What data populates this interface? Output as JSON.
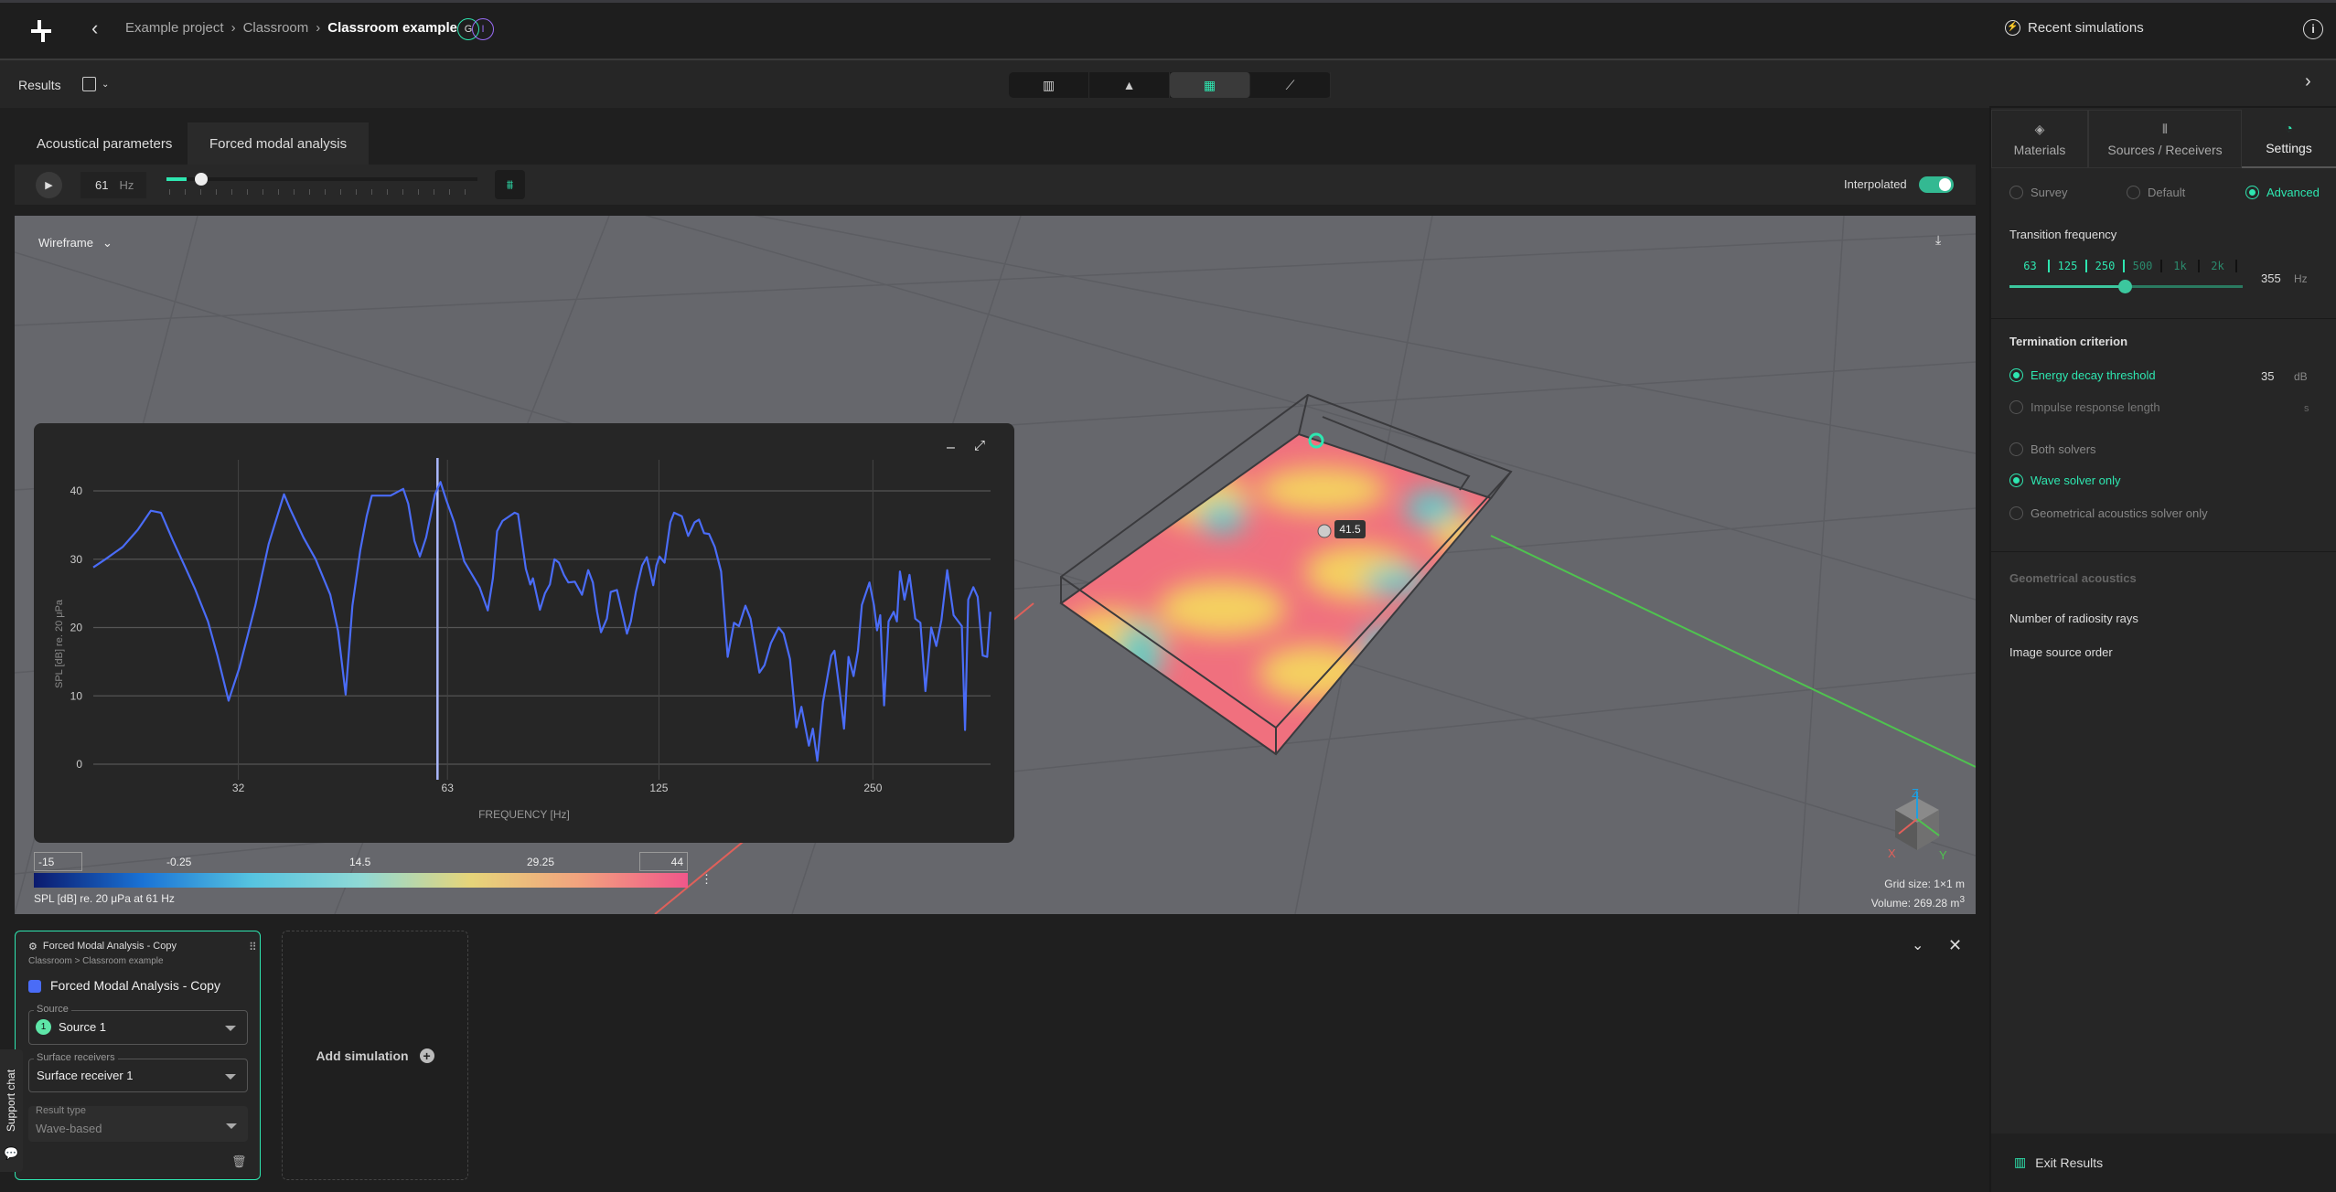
{
  "header": {
    "breadcrumb": [
      "Example project",
      "Classroom",
      "Classroom example"
    ],
    "separator": "›",
    "avatars": [
      "G",
      "I"
    ],
    "recent_simulations": "Recent simulations"
  },
  "toolbar": {
    "results_label": "Results",
    "view_buttons": [
      "results-chart-icon",
      "source-icon",
      "heatmap-icon",
      "graph-icon"
    ],
    "active_view": 2
  },
  "tabs": [
    {
      "label": "Acoustical parameters",
      "active": false
    },
    {
      "label": "Forced modal analysis",
      "active": true
    }
  ],
  "playback": {
    "frequency": "61",
    "unit": "Hz",
    "slider_fraction": 0.06,
    "interpolated_label": "Interpolated",
    "interpolated": true
  },
  "viewport": {
    "display_mode": "Wireframe",
    "probe_value": "41.5",
    "grid_size": "Grid size: 1×1 m",
    "volume": "Volume: 269.28 m",
    "volume_sup": "3",
    "axes": [
      "X",
      "Y",
      "Z"
    ]
  },
  "colorbar": {
    "min": "-15",
    "ticks": [
      "-0.25",
      "14.5",
      "29.25"
    ],
    "max": "44",
    "caption": "SPL [dB] re. 20 μPa at 61 Hz",
    "colors": [
      "#0b1a6e",
      "#1a73d6",
      "#56c4e0",
      "#8fd9d6",
      "#e6d57a",
      "#f2a37e",
      "#f0578a"
    ]
  },
  "chart_data": {
    "type": "line",
    "xlabel": "FREQUENCY [Hz]",
    "ylabel": "SPL [dB] re. 20 μPa",
    "x_scale": "log",
    "xlim": [
      20,
      366
    ],
    "ylim": [
      -2,
      44
    ],
    "x_ticks": [
      32,
      63,
      125,
      250
    ],
    "y_ticks": [
      0,
      10,
      20,
      30,
      40
    ],
    "grid": true,
    "marker_frequency": 61,
    "line_color": "#4a6cf7",
    "series": [
      {
        "x": [
          20,
          20.8,
          22,
          23.1,
          24.1,
          24.9,
          25.9,
          27,
          27.8,
          29,
          29.9,
          31,
          32.1,
          33.8,
          35.3,
          37.1,
          37.9,
          39.5,
          41.1,
          43.1,
          44.2,
          45.3,
          46.3,
          47.5,
          48.5,
          49.3,
          52.4,
          54.6,
          55.5,
          56.6,
          57.6,
          58.8,
          60.5,
          61.6,
          62.8,
          64.4,
          66.5,
          69.9,
          71.8,
          73,
          74,
          75.3,
          78.3,
          79.2,
          81.2,
          82.4,
          83.1,
          85,
          86.4,
          87.8,
          89.1,
          90.4,
          91.9,
          93.2,
          95.2,
          97.4,
          99.4,
          100.9,
          102.3,
          103.6,
          105.6,
          106.9,
          109.1,
          110.7,
          112.7,
          114.1,
          116,
          118.4,
          120.2,
          122.7,
          124,
          125.2,
          127.3,
          129.7,
          131.3,
          134.6,
          137.4,
          140.3,
          142.3,
          144.7,
          147,
          149.8,
          152.9,
          156.2,
          159.4,
          162,
          165.4,
          168.2,
          173.1,
          176,
          179.6,
          184.2,
          187.2,
          191.1,
          195.1,
          198.3,
          203.2,
          205.8,
          208.8,
          212.7,
          218.4,
          220.7,
          225.3,
          227.7,
          231,
          234.8,
          238.2,
          241.2,
          247.2,
          250.9,
          253.4,
          256,
          259.2,
          263,
          267.4,
          270.2,
          272.9,
          276.9,
          281.5,
          286.8,
          291.6,
          296.4,
          302,
          307,
          312.2,
          318,
          324.7,
          333.5,
          337,
          340.5,
          346.2,
          351,
          356.8,
          362,
          365.8
        ],
        "y": [
          28.8,
          30,
          31.8,
          34.3,
          37.1,
          36.8,
          32.7,
          28.6,
          25.7,
          20.9,
          15.9,
          9.3,
          14.1,
          23.2,
          32.2,
          39.5,
          37.2,
          33.2,
          30,
          24.8,
          19.5,
          10.2,
          23.2,
          31.3,
          36.3,
          39.3,
          39.3,
          40.3,
          38.1,
          32.7,
          30.4,
          33.2,
          39.5,
          41.3,
          38.6,
          35.4,
          29.7,
          25.9,
          22.5,
          27.2,
          34.1,
          35.6,
          36.8,
          36.6,
          28.6,
          26.3,
          27.2,
          22.6,
          25,
          26.3,
          30,
          29.5,
          27.7,
          26.6,
          26.7,
          24.8,
          28.4,
          26.6,
          22.3,
          19.3,
          21.3,
          25.2,
          25.5,
          22.7,
          19.1,
          20.9,
          25.2,
          29.1,
          30.3,
          26.2,
          29.1,
          30.4,
          29.5,
          35.4,
          36.8,
          36.3,
          33.4,
          35.4,
          35.8,
          33.8,
          33.7,
          31.8,
          28.2,
          15.7,
          20.7,
          20.2,
          23.2,
          21.3,
          13.4,
          14.5,
          17.7,
          20,
          19.1,
          15.4,
          5.4,
          8.4,
          2.7,
          5.2,
          0.5,
          9.1,
          15.9,
          16.6,
          9.3,
          5.2,
          15.7,
          12.9,
          16.6,
          23.3,
          26.6,
          23.2,
          19.6,
          21.8,
          8.6,
          20.9,
          22.3,
          20.9,
          28.2,
          24.1,
          27.7,
          21.3,
          20.7,
          10.7,
          20,
          17.3,
          21.1,
          28.4,
          21.8,
          20.2,
          5,
          24.1,
          25.9,
          24.5,
          15.9,
          15.7,
          22.3
        ]
      }
    ]
  },
  "right_panel": {
    "tabs": [
      {
        "label": "Materials",
        "icon": "layers-icon"
      },
      {
        "label": "Sources / Receivers",
        "icon": "waveform-icon"
      },
      {
        "label": "Settings",
        "icon": "settings-icon",
        "active": true
      }
    ],
    "presets": [
      {
        "label": "Survey",
        "selected": false
      },
      {
        "label": "Default",
        "selected": false
      },
      {
        "label": "Advanced",
        "selected": true
      }
    ],
    "transition_frequency": {
      "title": "Transition frequency",
      "bands": [
        "63",
        "125",
        "250",
        "500",
        "1k",
        "2k"
      ],
      "value": "355",
      "unit": "Hz",
      "slider_fraction": 0.5
    },
    "termination": {
      "title": "Termination criterion",
      "options": [
        {
          "label": "Energy decay threshold",
          "selected": true,
          "value": "35",
          "unit": "dB"
        },
        {
          "label": "Impulse response length",
          "selected": false,
          "value": "",
          "unit": "s"
        }
      ]
    },
    "solvers": [
      {
        "label": "Both solvers",
        "selected": false
      },
      {
        "label": "Wave solver only",
        "selected": true
      },
      {
        "label": "Geometrical acoustics solver only",
        "selected": false
      }
    ],
    "geometrical": {
      "title": "Geometrical acoustics",
      "items": [
        "Number of radiosity rays",
        "Image source order"
      ]
    },
    "exit_label": "Exit Results"
  },
  "simulation_card": {
    "header": "Forced Modal Analysis - Copy",
    "breadcrumb": "Classroom > Classroom example",
    "title": "Forced Modal Analysis - Copy",
    "color": "#4a6cf7",
    "source": {
      "label": "Source",
      "badge": "1",
      "value": "Source 1"
    },
    "receivers": {
      "label": "Surface receivers",
      "value": "Surface receiver 1"
    },
    "result_type": {
      "label": "Result type",
      "value": "Wave-based"
    }
  },
  "add_simulation": "Add simulation",
  "support_chat": "Support chat"
}
